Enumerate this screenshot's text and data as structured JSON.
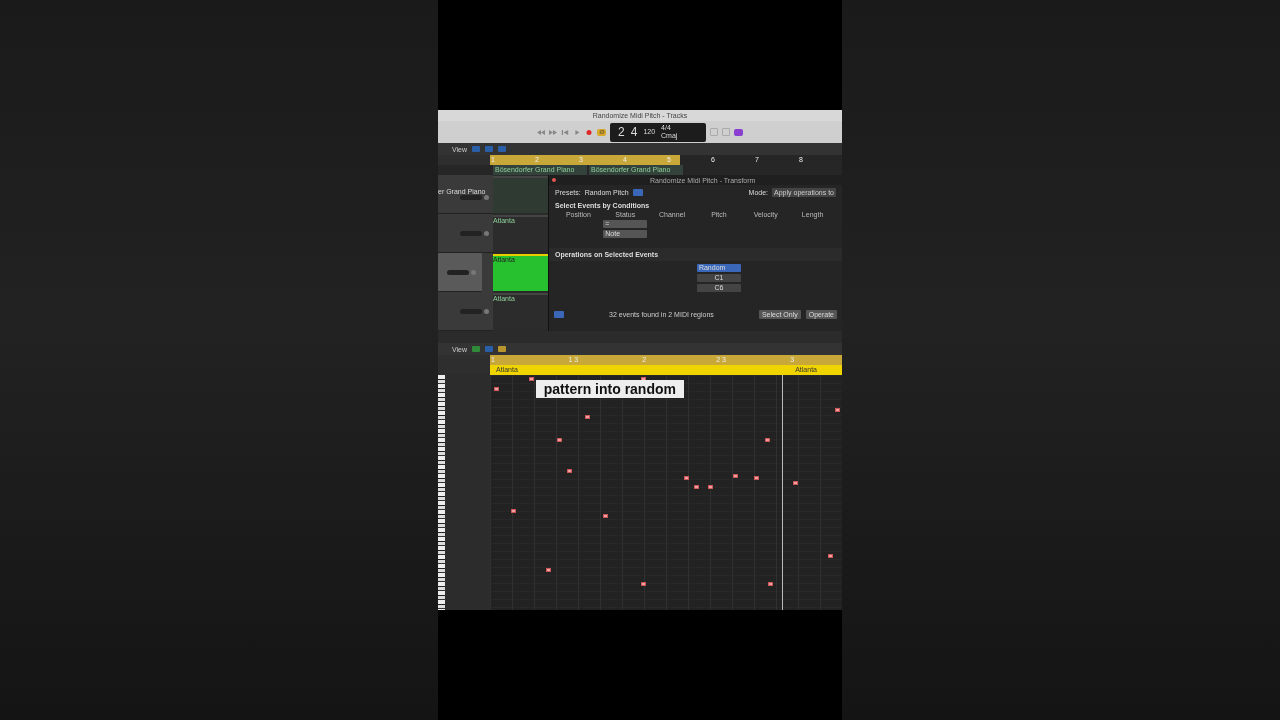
{
  "window": {
    "title": "Randomize Midi Pitch - Tracks"
  },
  "transport": {
    "lcd": {
      "bar": "2",
      "beat": "4",
      "tempo": "120",
      "signature": "4/4",
      "key": "Cmaj"
    },
    "cycle_on": true
  },
  "tracks_toolbar": {
    "menu": "View"
  },
  "tracks_ruler": [
    "1",
    "2",
    "3",
    "4",
    "5",
    "6",
    "7",
    "8"
  ],
  "region_lane": [
    "Bösendorfer Grand Piano",
    "Bösendorfer Grand Piano"
  ],
  "tracks": [
    {
      "name": "er Grand Piano",
      "selected": false
    },
    {
      "region": "Atlanta",
      "selected": false
    },
    {
      "region": "Atlanta",
      "selected": true
    },
    {
      "region": "Atlanta",
      "selected": false
    }
  ],
  "transform": {
    "title": "Randomize Midi Pitch - Transform",
    "presets_label": "Presets:",
    "preset": "Random Pitch",
    "mode_label": "Mode:",
    "mode": "Apply operations to",
    "conditions_title": "Select Events by Conditions",
    "columns": [
      "Position",
      "Status",
      "Channel",
      "Pitch",
      "Velocity",
      "Length"
    ],
    "status_condition": "=",
    "status_value": "Note",
    "operations_title": "Operations on Selected Events",
    "pitch_operation": "Random",
    "pitch_low": "C1",
    "pitch_high": "C6",
    "result": "32 events found in 2 MIDI regions",
    "buttons": [
      "Select Only",
      "Operate"
    ]
  },
  "piano_roll": {
    "menu": "View",
    "ruler": [
      "1",
      "1 3",
      "2",
      "2 3",
      "3"
    ],
    "regions": [
      "Atlanta",
      "Atlanta"
    ]
  },
  "caption": "pattern into random"
}
